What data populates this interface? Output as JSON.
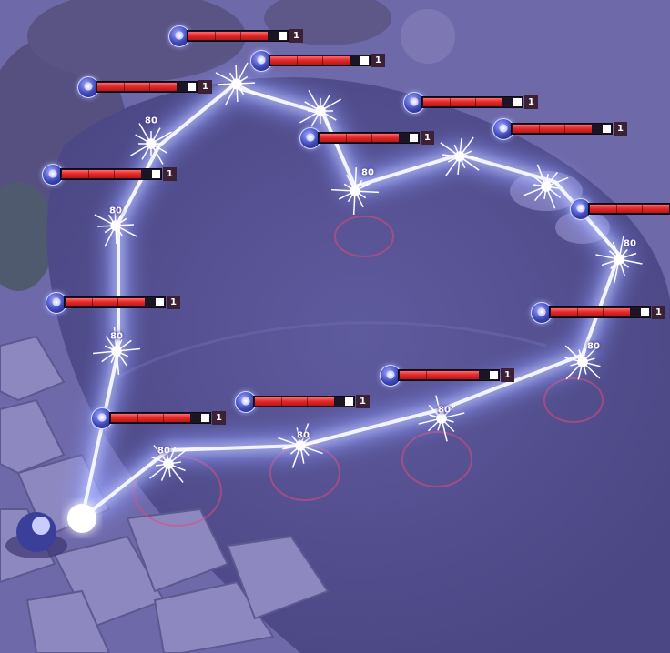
{
  "scene": {
    "colors": {
      "ground": "#6b66a8",
      "water": "#534f8e",
      "chain": "#eef2ff",
      "chain_glow": "#7f8cff",
      "hp_red": "#e52a2a",
      "hp_white": "#ffffff",
      "badge_blue": "#3d46b8"
    }
  },
  "units": [
    {
      "id": "u1",
      "hp_fraction": 0.86,
      "count": "1"
    },
    {
      "id": "u2",
      "hp_fraction": 0.86,
      "count": "1"
    },
    {
      "id": "u3",
      "hp_fraction": 0.86,
      "count": "1"
    },
    {
      "id": "u4",
      "hp_fraction": 0.86,
      "count": "1"
    },
    {
      "id": "u5",
      "hp_fraction": 0.86,
      "count": "1"
    },
    {
      "id": "u6",
      "hp_fraction": 0.86,
      "count": "1"
    },
    {
      "id": "u7",
      "hp_fraction": 0.86,
      "count": "1"
    },
    {
      "id": "u8",
      "hp_fraction": 0.86,
      "count": "1"
    },
    {
      "id": "u9",
      "hp_fraction": 0.86,
      "count": "1"
    },
    {
      "id": "u10",
      "hp_fraction": 0.86,
      "count": "1"
    },
    {
      "id": "u11",
      "hp_fraction": 0.86,
      "count": "1"
    },
    {
      "id": "u12",
      "hp_fraction": 0.86,
      "count": "1"
    },
    {
      "id": "u13",
      "hp_fraction": 0.86,
      "count": "1"
    },
    {
      "id": "u14",
      "hp_fraction": 0.86,
      "count": "1"
    }
  ],
  "damage_numbers": [
    "80",
    "80",
    "80",
    "80",
    "80",
    "80",
    "80",
    "80",
    "80"
  ]
}
